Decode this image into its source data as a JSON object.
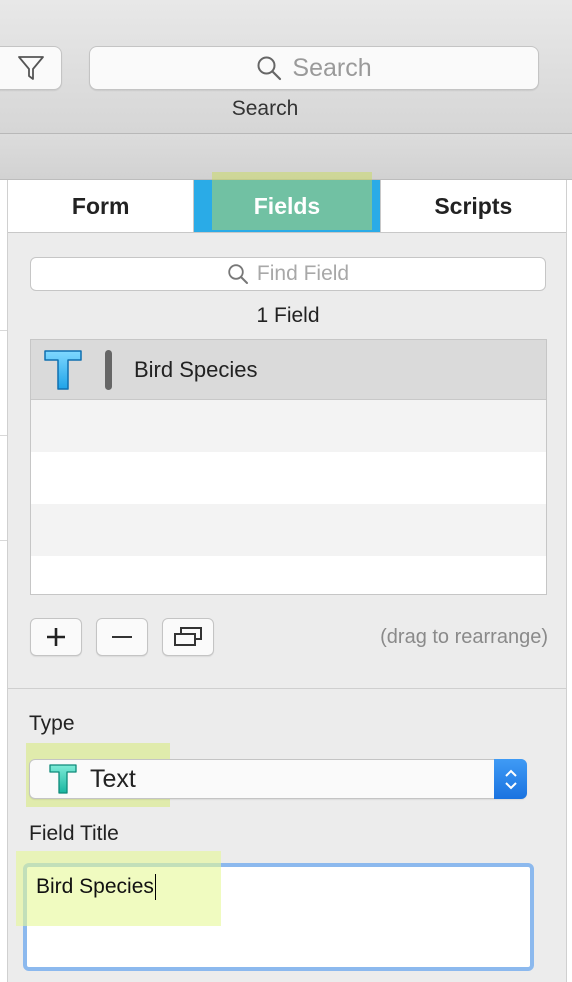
{
  "toolbar": {
    "search_placeholder": "Search",
    "search_caption": "Search"
  },
  "tabs": [
    {
      "label": "Form",
      "active": false
    },
    {
      "label": "Fields",
      "active": true
    },
    {
      "label": "Scripts",
      "active": false
    }
  ],
  "fields_panel": {
    "find_placeholder": "Find Field",
    "field_count": "1 Field",
    "fields": [
      {
        "name": "Bird Species",
        "type_icon": "text-type-icon"
      }
    ],
    "drag_hint": "(drag to rearrange)"
  },
  "inspector": {
    "type_label": "Type",
    "type_value": "Text",
    "title_label": "Field Title",
    "title_value": "Bird Species"
  },
  "colors": {
    "accent": "#2aabe7",
    "focus_ring": "#8cb9ee",
    "highlight": "#d7eb78"
  }
}
